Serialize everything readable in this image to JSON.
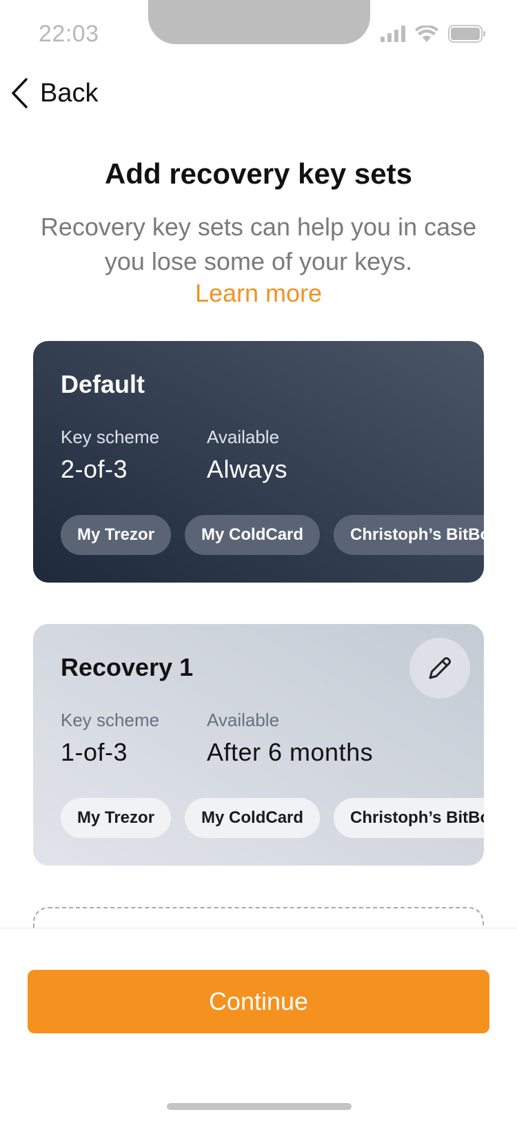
{
  "status_bar": {
    "time": "22:03"
  },
  "nav": {
    "back_label": "Back"
  },
  "header": {
    "title": "Add recovery key sets",
    "subtitle": "Recovery key sets can help you in case you lose some of your keys.",
    "learn_more": "Learn more"
  },
  "cards": [
    {
      "title": "Default",
      "key_scheme_label": "Key scheme",
      "key_scheme": "2-of-3",
      "available_label": "Available",
      "available": "Always",
      "keys": [
        "My Trezor",
        "My ColdCard",
        "Christoph’s BitBox"
      ]
    },
    {
      "title": "Recovery 1",
      "key_scheme_label": "Key scheme",
      "key_scheme": "1-of-3",
      "available_label": "Available",
      "available": "After 6 months",
      "keys": [
        "My Trezor",
        "My ColdCard",
        "Christoph’s BitBox"
      ]
    }
  ],
  "footer": {
    "continue_label": "Continue"
  },
  "icons": {
    "back": "chevron-left-icon",
    "edit": "pencil-icon",
    "signal": "cellular-signal-icon",
    "wifi": "wifi-icon",
    "battery": "battery-icon"
  },
  "colors": {
    "accent": "#f5911e",
    "default_card": "#2a3546",
    "recovery_card": "#d2d7df"
  }
}
